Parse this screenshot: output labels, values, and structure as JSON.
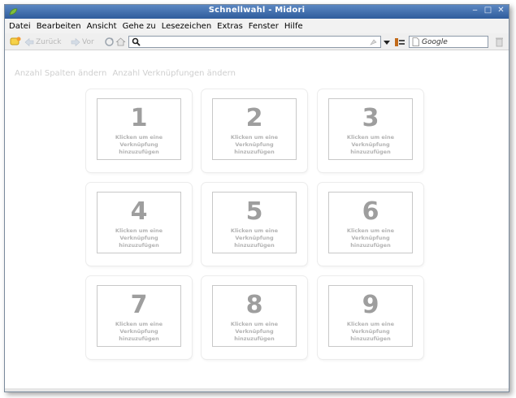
{
  "window": {
    "title": "Schnellwahl - Midori",
    "controls": [
      "‒",
      "□",
      "✕"
    ]
  },
  "menu": [
    "Datei",
    "Bearbeiten",
    "Ansicht",
    "Gehe zu",
    "Lesezeichen",
    "Extras",
    "Fenster",
    "Hilfe"
  ],
  "toolbar": {
    "back": "Zurück",
    "forward": "Vor",
    "address_value": "",
    "search_placeholder": "Google"
  },
  "actions": {
    "columns": "Anzahl Spalten ändern",
    "links": "Anzahl Verknüpfungen ändern"
  },
  "tiles": [
    {
      "num": "1",
      "text": "Klicken um eine Verknüpfung hinzuzufügen"
    },
    {
      "num": "2",
      "text": "Klicken um eine Verknüpfung hinzuzufügen"
    },
    {
      "num": "3",
      "text": "Klicken um eine Verknüpfung hinzuzufügen"
    },
    {
      "num": "4",
      "text": "Klicken um eine Verknüpfung hinzuzufügen"
    },
    {
      "num": "5",
      "text": "Klicken um eine Verknüpfung hinzuzufügen"
    },
    {
      "num": "6",
      "text": "Klicken um eine Verknüpfung hinzuzufügen"
    },
    {
      "num": "7",
      "text": "Klicken um eine Verknüpfung hinzuzufügen"
    },
    {
      "num": "8",
      "text": "Klicken um eine Verknüpfung hinzuzufügen"
    },
    {
      "num": "9",
      "text": "Klicken um eine Verknüpfung hinzuzufügen"
    }
  ]
}
